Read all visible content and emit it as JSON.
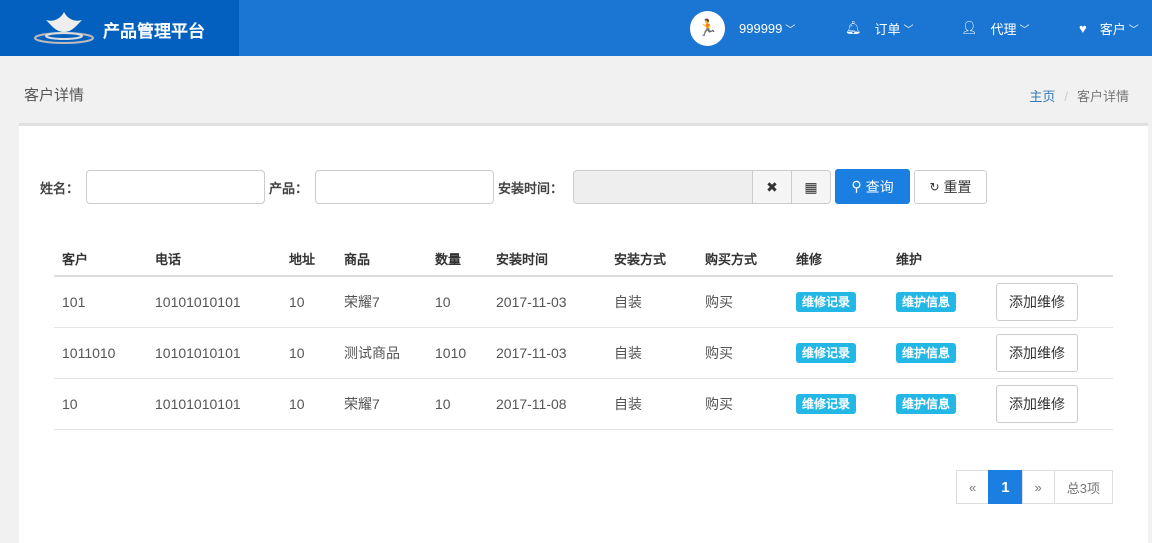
{
  "header": {
    "title": "产品管理平台",
    "user": "999999",
    "nav": [
      {
        "label": "订单",
        "icon": "bell-icon"
      },
      {
        "label": "代理",
        "icon": "user-icon"
      },
      {
        "label": "客户",
        "icon": "heart-icon"
      }
    ]
  },
  "page": {
    "title": "客户详情",
    "breadcrumb": [
      "主页",
      "客户详情"
    ]
  },
  "search": {
    "name_label": "姓名：",
    "product_label": "产品：",
    "time_label": "安装时间：",
    "query": "查询",
    "reset": "重置"
  },
  "table": {
    "headers": [
      "客户",
      "电话",
      "地址",
      "商品",
      "数量",
      "安装时间",
      "安装方式",
      "购买方式",
      "维修",
      "维护"
    ],
    "rows": [
      [
        "101",
        "10101010101",
        "10",
        "荣耀7",
        "10",
        "2017-11-03",
        "自装",
        "购买"
      ],
      [
        "1011010",
        "10101010101",
        "10",
        "测试商品",
        "1010",
        "2017-11-03",
        "自装",
        "购买"
      ],
      [
        "10",
        "10101010101",
        "10",
        "荣耀7",
        "10",
        "2017-11-08",
        "自装",
        "购买"
      ]
    ],
    "repair_badge": "维修记录",
    "maint_badge": "维护信息",
    "add_button": "添加维修"
  },
  "pager": {
    "prev": "«",
    "current": "1",
    "next": "»",
    "total": "总3项"
  }
}
